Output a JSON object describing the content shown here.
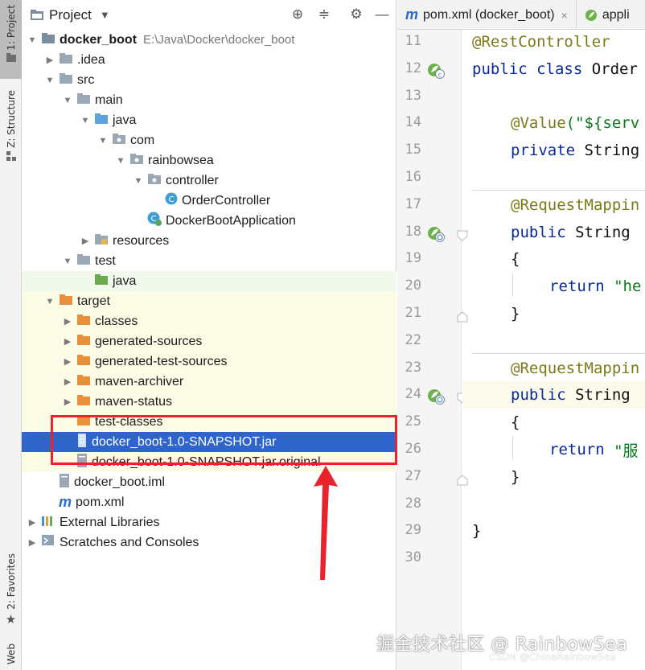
{
  "toolstrip": {
    "project_tab": "1: Project",
    "structure_tab": "Z: Structure",
    "favorites_tab": "2: Favorites",
    "web_tab": "Web"
  },
  "project_panel": {
    "title": "Project",
    "tree": [
      {
        "label": "docker_boot",
        "path": "E:\\Java\\Docker\\docker_boot"
      },
      {
        "label": ".idea"
      },
      {
        "label": "src"
      },
      {
        "label": "main"
      },
      {
        "label": "java"
      },
      {
        "label": "com"
      },
      {
        "label": "rainbowsea"
      },
      {
        "label": "controller"
      },
      {
        "label": "OrderController"
      },
      {
        "label": "DockerBootApplication"
      },
      {
        "label": "resources"
      },
      {
        "label": "test"
      },
      {
        "label": "java"
      },
      {
        "label": "target"
      },
      {
        "label": "classes"
      },
      {
        "label": "generated-sources"
      },
      {
        "label": "generated-test-sources"
      },
      {
        "label": "maven-archiver"
      },
      {
        "label": "maven-status"
      },
      {
        "label": "test-classes"
      },
      {
        "label": "docker_boot-1.0-SNAPSHOT.jar"
      },
      {
        "label": "docker_boot-1.0-SNAPSHOT.jar.original"
      },
      {
        "label": "docker_boot.iml"
      },
      {
        "label": "pom.xml"
      },
      {
        "label": "External Libraries"
      },
      {
        "label": "Scratches and Consoles"
      }
    ]
  },
  "editor": {
    "tabs": [
      {
        "label": "pom.xml (docker_boot)",
        "close": "×"
      },
      {
        "label": "appli"
      }
    ],
    "line_numbers": [
      "11",
      "12",
      "13",
      "14",
      "15",
      "16",
      "17",
      "18",
      "19",
      "20",
      "21",
      "22",
      "23",
      "24",
      "25",
      "26",
      "27",
      "28",
      "29",
      "30"
    ],
    "code": {
      "l11": "@RestController",
      "l12_kw": "public class ",
      "l12_rest": "Order",
      "l14_ann": "@Value",
      "l14_rest": "(\"${serv",
      "l15_kw": "private ",
      "l15_rest": "String",
      "l17": "@RequestMappin",
      "l18_kw": "public ",
      "l18_rest": "String ",
      "l19": "{",
      "l20_kw": "return ",
      "l20_str": "\"he",
      "l21": "}",
      "l23": "@RequestMappin",
      "l24_kw": "public ",
      "l24_rest": "String ",
      "l25": "{",
      "l26_kw": "return ",
      "l26_str": "\"服",
      "l27": "}",
      "l29": "}"
    }
  },
  "watermark": {
    "main": "掘金技术社区 @ RainbowSea",
    "sub": "CSDN @ChinaRainbowSea"
  },
  "colors": {
    "selection": "#2f65ca",
    "highlight_box": "#e8232b",
    "keyword": "#0a2a9a",
    "annotation": "#7a7a18",
    "string": "#0a7a1a"
  }
}
